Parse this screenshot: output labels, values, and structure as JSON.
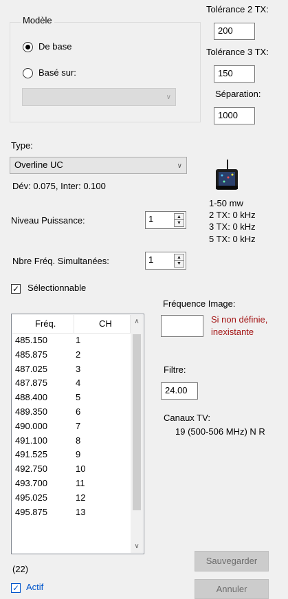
{
  "model_group": {
    "title": "Modèle",
    "option_base": "De base",
    "option_based_on": "Basé sur:",
    "selected": "De base",
    "based_on_value": ""
  },
  "tolerances": {
    "tol2_label": "Tolérance 2 TX:",
    "tol2_value": "200",
    "tol3_label": "Tolérance 3 TX:",
    "tol3_value": "150",
    "separation_label": "Séparation:",
    "separation_value": "1000"
  },
  "type": {
    "label": "Type:",
    "value": "Overline UC",
    "deviation": "Dév: 0.075, Inter: 0.100"
  },
  "device_info": {
    "power": "1-50 mw",
    "tx2": "2 TX: 0 kHz",
    "tx3": "3 TX: 0 kHz",
    "tx5": "5 TX: 0 kHz"
  },
  "power_level": {
    "label": "Niveau Puissance:",
    "value": "1"
  },
  "simultaneous": {
    "label": "Nbre Fréq. Simultanées:",
    "value": "1"
  },
  "selectable": {
    "label": "Sélectionnable",
    "checked": true
  },
  "image_frequency": {
    "label": "Fréquence Image:",
    "value": "",
    "note_line1": "Si non définie,",
    "note_line2": "inexistante",
    "note_color": "#a31515"
  },
  "filter": {
    "label": "Filtre:",
    "value": "24.00"
  },
  "tv_channels": {
    "label": "Canaux TV:",
    "value": "19 (500-506 MHz) N  R"
  },
  "freq_list": {
    "col_freq": "Fréq.",
    "col_ch": "CH",
    "rows": [
      {
        "freq": "485.150",
        "ch": "1"
      },
      {
        "freq": "485.875",
        "ch": "2"
      },
      {
        "freq": "487.025",
        "ch": "3"
      },
      {
        "freq": "487.875",
        "ch": "4"
      },
      {
        "freq": "488.400",
        "ch": "5"
      },
      {
        "freq": "489.350",
        "ch": "6"
      },
      {
        "freq": "490.000",
        "ch": "7"
      },
      {
        "freq": "491.100",
        "ch": "8"
      },
      {
        "freq": "491.525",
        "ch": "9"
      },
      {
        "freq": "492.750",
        "ch": "10"
      },
      {
        "freq": "493.700",
        "ch": "11"
      },
      {
        "freq": "495.025",
        "ch": "12"
      },
      {
        "freq": "495.875",
        "ch": "13"
      }
    ]
  },
  "count": "(22)",
  "active": {
    "label": "Actif",
    "checked": true,
    "color": "#0055cc"
  },
  "buttons": {
    "save": "Sauvegarder",
    "cancel": "Annuler"
  }
}
